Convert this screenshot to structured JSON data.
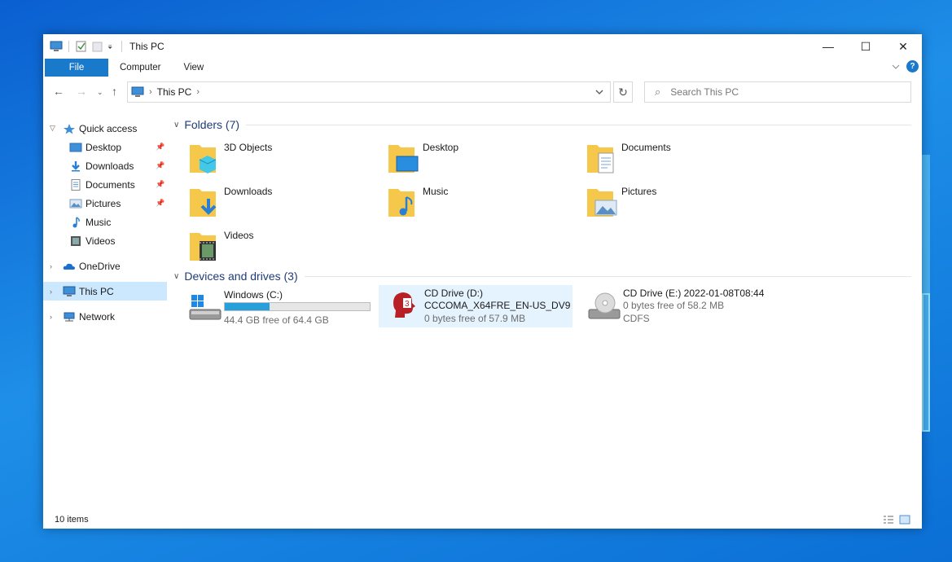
{
  "window": {
    "title": "This PC",
    "controls": {
      "minimize": "—",
      "maximize": "☐",
      "close": "✕"
    }
  },
  "ribbon": {
    "tabs": [
      "File",
      "Computer",
      "View"
    ]
  },
  "address": {
    "crumb": "This PC",
    "chevron": "›",
    "search_placeholder": "Search This PC"
  },
  "sidebar": {
    "quick_access": "Quick access",
    "quick_items": [
      {
        "label": "Desktop",
        "icon": "desktop-icon",
        "pinned": true
      },
      {
        "label": "Downloads",
        "icon": "downloads-icon",
        "pinned": true
      },
      {
        "label": "Documents",
        "icon": "documents-icon",
        "pinned": true
      },
      {
        "label": "Pictures",
        "icon": "pictures-icon",
        "pinned": true
      },
      {
        "label": "Music",
        "icon": "music-icon",
        "pinned": false
      },
      {
        "label": "Videos",
        "icon": "videos-icon",
        "pinned": false
      }
    ],
    "onedrive": "OneDrive",
    "this_pc": "This PC",
    "network": "Network"
  },
  "folders": {
    "header": "Folders (7)",
    "items": [
      "3D Objects",
      "Desktop",
      "Documents",
      "Downloads",
      "Music",
      "Pictures",
      "Videos"
    ]
  },
  "drives": {
    "header": "Devices and drives (3)",
    "items": [
      {
        "label": "Windows (C:)",
        "free": "44.4 GB free of 64.4 GB",
        "used_fraction": 0.31
      },
      {
        "label": "CD Drive (D:)",
        "volume": "CCCOMA_X64FRE_EN-US_DV9",
        "free": "0 bytes free of 57.9 MB"
      },
      {
        "label": "CD Drive (E:) 2022-01-08T08:44",
        "free": "0 bytes free of 58.2 MB",
        "fs": "CDFS"
      }
    ]
  },
  "status": {
    "items": "10 items"
  },
  "colors": {
    "accent": "#1979ca",
    "selection": "#cce8ff",
    "bar_fill": "#26a0da",
    "group_title": "#1e3c78"
  }
}
